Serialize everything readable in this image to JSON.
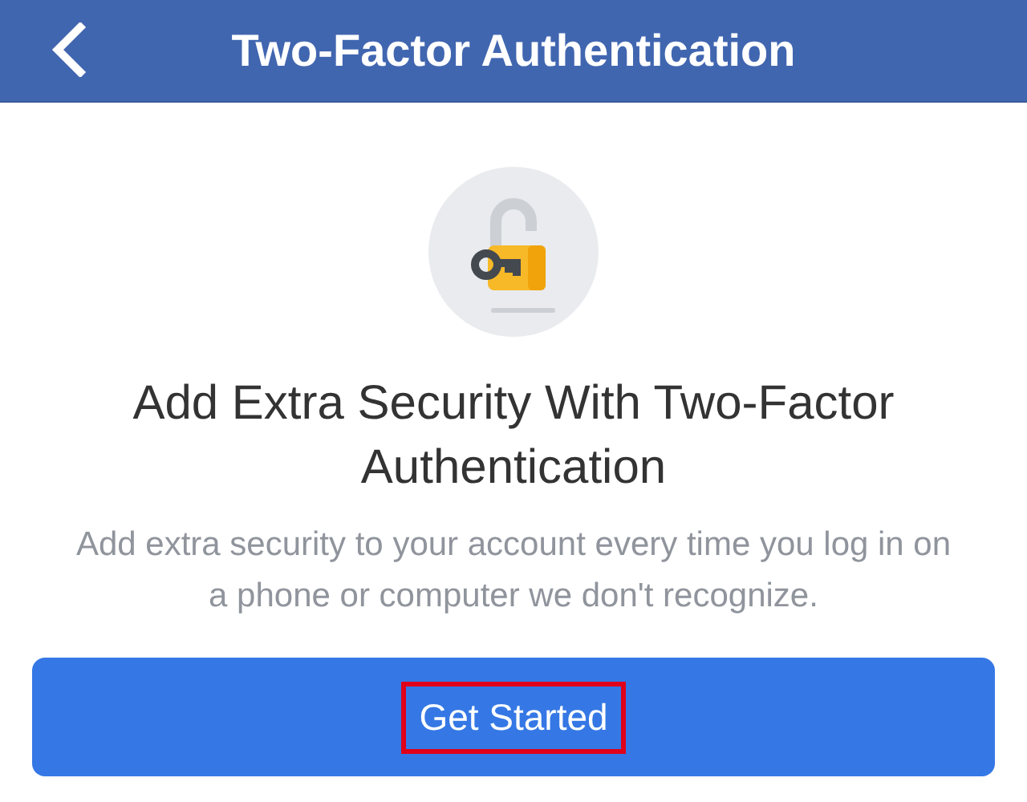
{
  "header": {
    "title": "Two-Factor Authentication"
  },
  "heading": "Add Extra Security With Two-Factor Authentication",
  "description": "Add extra security to your account every time you log in on a phone or computer we don't recognize.",
  "button": {
    "label": "Get Started",
    "highlighted": true
  }
}
